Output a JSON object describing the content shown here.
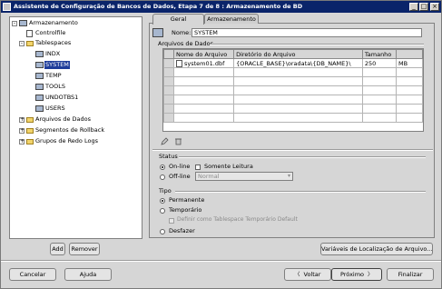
{
  "window": {
    "title": "Assistente de Configuração de Bancos de Dados, Etapa 7 de 8 : Armazenamento de BD"
  },
  "tree": {
    "items": [
      {
        "label": "Armazenamento",
        "icon": "database-icon",
        "expanded": true
      },
      {
        "label": "Controlfile",
        "icon": "controlfile-icon"
      },
      {
        "label": "Tablespaces",
        "icon": "folder-icon",
        "expanded": true
      },
      {
        "label": "INDX",
        "icon": "tablespace-icon"
      },
      {
        "label": "SYSTEM",
        "icon": "tablespace-icon",
        "selected": true
      },
      {
        "label": "TEMP",
        "icon": "tablespace-icon"
      },
      {
        "label": "TOOLS",
        "icon": "tablespace-icon"
      },
      {
        "label": "UNDOTBS1",
        "icon": "tablespace-icon"
      },
      {
        "label": "USERS",
        "icon": "tablespace-icon"
      },
      {
        "label": "Arquivos de Dados",
        "icon": "folder-icon"
      },
      {
        "label": "Segmentos de Rollback",
        "icon": "folder-icon"
      },
      {
        "label": "Grupos de Redo Logs",
        "icon": "folder-icon"
      }
    ]
  },
  "tree_buttons": {
    "add": "Add",
    "remove": "Remover"
  },
  "tabs": [
    {
      "label": "Geral",
      "active": true
    },
    {
      "label": "Armazenamento",
      "active": false
    }
  ],
  "general": {
    "name_label": "Nome:",
    "name_value": "SYSTEM",
    "datafiles_label": "Arquivos de Dados",
    "columns": [
      "Nome do Arquivo",
      "Diretório do Arquivo",
      "Tamanho",
      ""
    ],
    "rows": [
      {
        "file": "system01.dbf",
        "dir": "{ORACLE_BASE}\\oradata\\{DB_NAME}\\",
        "size": "250",
        "unit": "MB"
      }
    ],
    "status_label": "Status",
    "online_label": "On-line",
    "readonly_label": "Somente Leitura",
    "offline_label": "Off-line",
    "offline_mode": "Normal",
    "type_label": "Tipo",
    "permanent_label": "Permanente",
    "temporary_label": "Temporário",
    "default_temp_label": "Definir como Tablespace Temporário Default",
    "undo_label": "Desfazer"
  },
  "location_button": "Variáveis de Localização de Arquivo...",
  "footer": {
    "cancel": "Cancelar",
    "help": "Ajuda",
    "back": "Voltar",
    "next": "Próximo",
    "finish": "Finalizar",
    "back_arrow": "〈",
    "next_arrow": "〉"
  },
  "colors": {
    "titlebar": "#0a246a",
    "selection": "#1e3c9a"
  }
}
